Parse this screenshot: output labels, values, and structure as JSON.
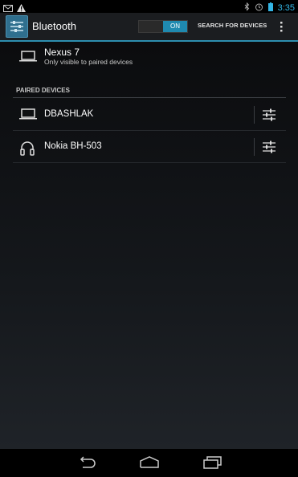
{
  "status_bar": {
    "time": "3:35",
    "icons": [
      "gmail-icon",
      "warning-icon",
      "bluetooth-icon",
      "alarm-icon",
      "battery-icon"
    ]
  },
  "action_bar": {
    "title": "Bluetooth",
    "toggle_label": "ON",
    "search_label": "SEARCH FOR DEVICES"
  },
  "this_device": {
    "name": "Nexus 7",
    "visibility": "Only visible to paired devices"
  },
  "paired_section": {
    "header": "PAIRED DEVICES",
    "devices": [
      {
        "name": "DBASHLAK",
        "icon": "laptop-icon"
      },
      {
        "name": "Nokia BH-503",
        "icon": "headset-icon"
      }
    ]
  },
  "colors": {
    "accent": "#33b5e5",
    "toggle_on": "#1f8ab0"
  }
}
